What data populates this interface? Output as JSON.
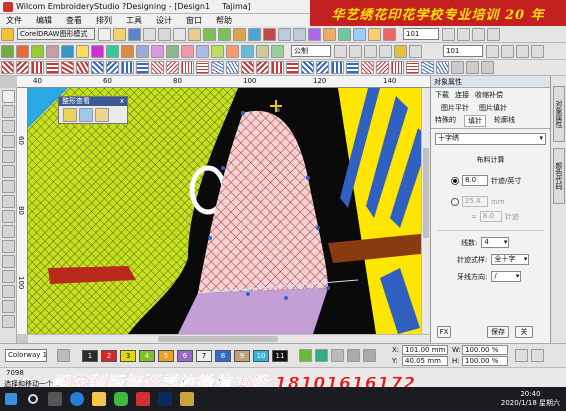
{
  "window": {
    "title": "Wilcom EmbroideryStudio ?Designing - [Design1",
    "title_extra": "Tajima]",
    "window_buttons": [
      "–",
      "□",
      "×"
    ]
  },
  "menu": [
    "文件",
    "编辑",
    "查看",
    "排列",
    "工具",
    "设计",
    "窗口",
    "帮助"
  ],
  "banner_top": "华艺绣花印花学校专业培训 20 年",
  "toolbar1": {
    "mode_button": "CorelDRAW图形模式",
    "zoom_value": "101"
  },
  "toolbar2": {
    "unit_combo": "公制",
    "zoom_value": "101"
  },
  "ruler_h_ticks": [
    "40",
    "60",
    "80",
    "100",
    "120",
    "140"
  ],
  "ruler_v_ticks": [
    "60",
    "80",
    "100"
  ],
  "shape_view_panel": {
    "title": "整形查看",
    "close": "x"
  },
  "docker": {
    "title": "对象属性",
    "tabs_row1": [
      "下载",
      "连接",
      "收缩补偿"
    ],
    "tabs_row2": [
      "图片平针",
      "图片填针"
    ],
    "tabs_row3": [
      "特殊的",
      "填针",
      "轮廓线"
    ],
    "stitch_type": "十字绣",
    "section_title": "布料计算",
    "density_value": "8.0",
    "density_unit": "针迹/英寸",
    "spacing_value": "25.4",
    "spacing_unit": "mm",
    "sub_value": "8.0",
    "sub_unit": "针迹",
    "thread_label": "线数:",
    "thread_value": "4",
    "style_label": "针迹式样:",
    "style_value": "全十字",
    "direction_label": "牙线方向:",
    "direction_value": "/",
    "fx_label": "FX",
    "save_label": "保存",
    "close_label": "关",
    "side_tabs": [
      "对象属性",
      "颜色代码"
    ]
  },
  "bottom_bar": {
    "colorway": "Colorway 1",
    "color_swatches": [
      "#2b2b2b",
      "#d92626",
      "#e8d800",
      "#7fbf2a",
      "#f0a020",
      "#9a67d1",
      "#f0f0f0",
      "#2f6ad0",
      "#c2a27a",
      "#2fb4e6",
      "#111111"
    ],
    "x_label": "X:",
    "x_value": "101.00 mm",
    "w_label": "W:",
    "w_value": "100.00 %",
    "y_label": "Y:",
    "y_value": "40.05 mm",
    "h_label": "H:",
    "h_value": "100.00 %"
  },
  "status": {
    "stitch_count": "7098",
    "hint": "选择和移动一个...",
    "phone_banner": "绣花制版培训学校微信电话 18101616172"
  },
  "taskbar": {
    "time": "20:40",
    "date": "2020/1/18 星期六"
  },
  "colors": {
    "banner_red": "#c42020",
    "banner_yellow": "#ffe300",
    "canvas_sky": "#29a8e3",
    "fish_green": "#c6e020",
    "stripe_yellow": "#ffe600",
    "stripe_blue": "#3060c0",
    "net_pink": "#f2d4d4",
    "fin_lavender": "#c39fd6"
  }
}
